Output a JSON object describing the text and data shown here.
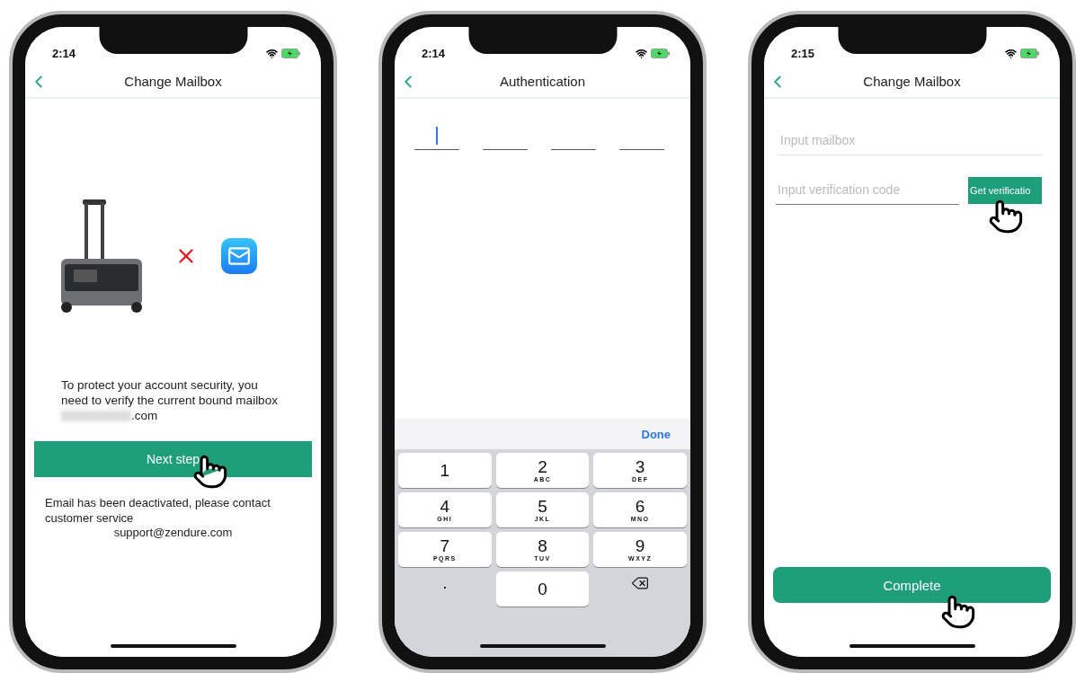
{
  "phones": [
    {
      "kind": "current_mailbox",
      "time": "2:14",
      "title": "Change Mailbox",
      "notice": "To protect your account security, you need to verify the current bound mailbox",
      "notice_end": ".com",
      "button": "Next step",
      "deactivated": "Email has been deactivated, please contact customer service",
      "support_email": "support@zendure.com"
    },
    {
      "kind": "authentication",
      "time": "2:14",
      "title": "Authentication",
      "code_slots": [
        {
          "selected": true
        },
        {
          "selected": false
        },
        {
          "selected": false
        },
        {
          "selected": false
        }
      ],
      "done": "Done",
      "keys": [
        {
          "kind": "digit",
          "digit": "1"
        },
        {
          "kind": "digit",
          "digit": "2",
          "letters": "ABC"
        },
        {
          "kind": "digit",
          "digit": "3",
          "letters": "DEF"
        },
        {
          "kind": "digit",
          "digit": "4",
          "letters": "GHI"
        },
        {
          "kind": "digit",
          "digit": "5",
          "letters": "JKL"
        },
        {
          "kind": "digit",
          "digit": "6",
          "letters": "MNO"
        },
        {
          "kind": "digit",
          "digit": "7",
          "letters": "PQRS"
        },
        {
          "kind": "digit",
          "digit": "8",
          "letters": "TUV"
        },
        {
          "kind": "digit",
          "digit": "9",
          "letters": "WXYZ"
        },
        {
          "kind": "symbol",
          "digit": "."
        },
        {
          "kind": "digit",
          "digit": "0"
        },
        {
          "kind": "delete"
        }
      ]
    },
    {
      "kind": "new_mailbox",
      "time": "2:15",
      "title": "Change Mailbox",
      "mailbox": {
        "placeholder": "Input mailbox"
      },
      "code": {
        "placeholder": "Input verification code"
      },
      "code_button": "Get verificatio",
      "button": "Complete"
    }
  ]
}
